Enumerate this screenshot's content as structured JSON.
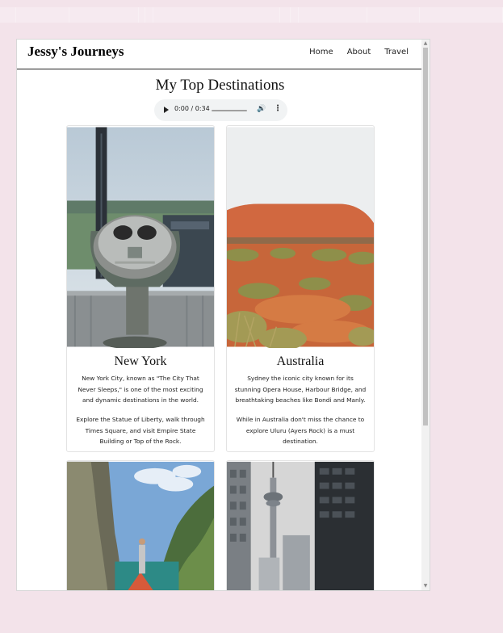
{
  "brand": "Jessy's Journeys",
  "nav": [
    "Home",
    "About",
    "Travel"
  ],
  "title": "My Top Destinations",
  "audio": {
    "time": "0:00 / 0:34"
  },
  "cards": [
    {
      "title": "New York",
      "p1": "New York City, known as \"The City That Never Sleeps,\" is one of the most exciting and dynamic destinations in the world.",
      "p2": "Explore the Statue of Liberty, walk through Times Square, and visit Empire State Building or Top of the Rock."
    },
    {
      "title": "Australia",
      "p1": "Sydney the iconic city known for its stunning Opera House, Harbour Bridge, and breathtaking beaches like Bondi and Manly.",
      "p2": "While in Australia don't miss the chance to explore Uluru (Ayers Rock) is a must destination."
    }
  ],
  "icons": {
    "play": "play-icon",
    "volume": "volume-icon",
    "more": "more-options-icon"
  }
}
